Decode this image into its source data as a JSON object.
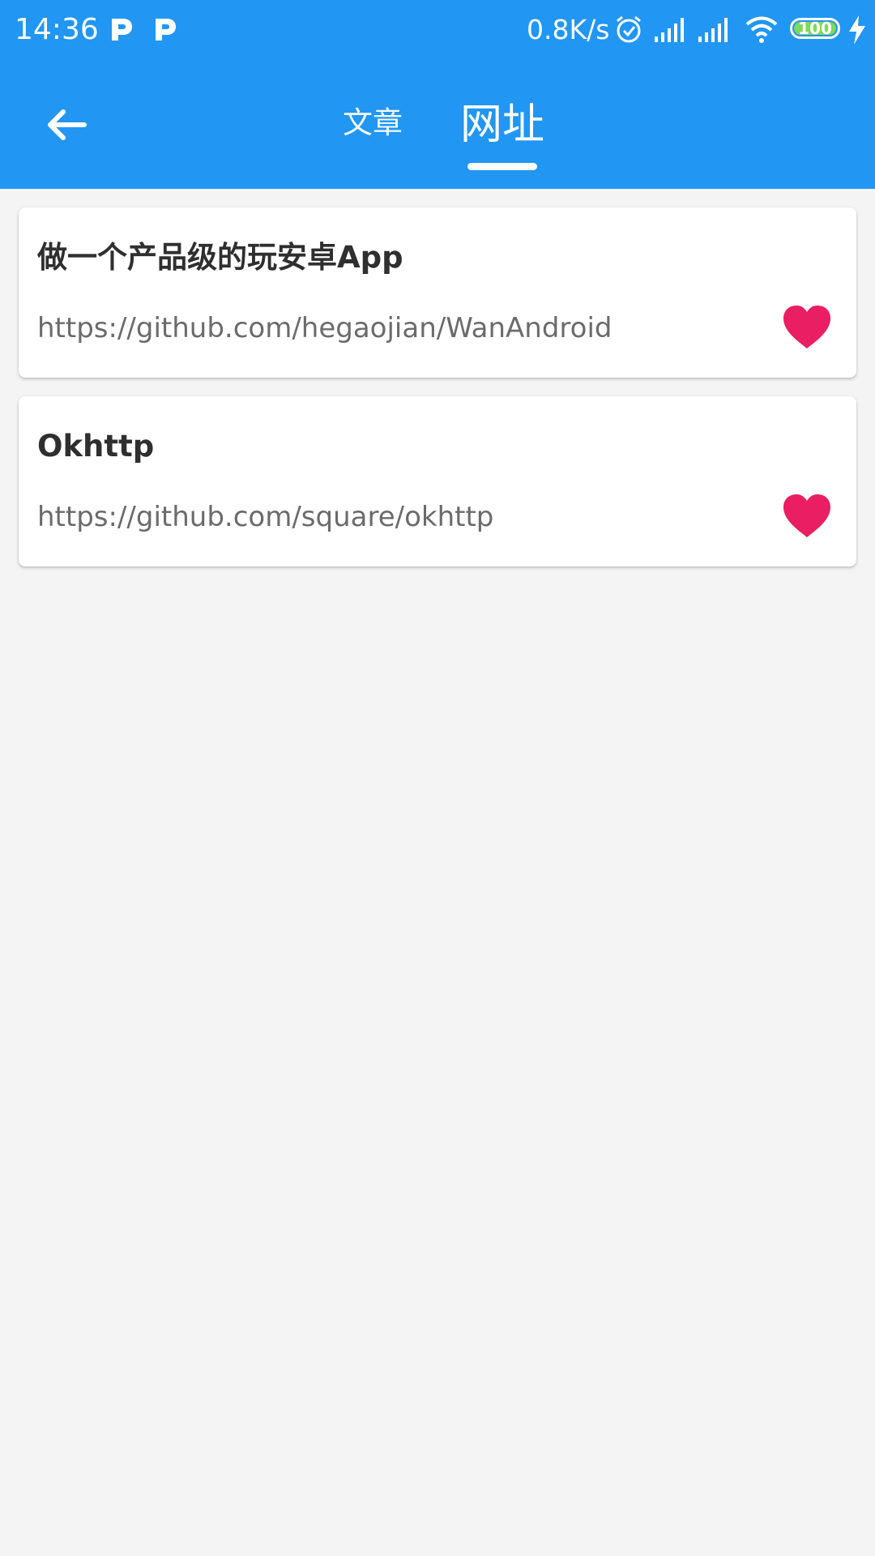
{
  "status_bar": {
    "time": "14:36",
    "net_speed": "0.8K/s",
    "battery": "100",
    "icons": [
      "parking-icon",
      "parking-icon",
      "alarm-icon",
      "signal-icon",
      "signal-icon",
      "wifi-icon",
      "battery-icon",
      "charging-icon"
    ]
  },
  "toolbar": {
    "tabs": [
      {
        "label": "文章"
      },
      {
        "label": "网址"
      }
    ],
    "selected_tab": "网址"
  },
  "collections": [
    {
      "title": "做一个产品级的玩安卓App",
      "url": "https://github.com/hegaojian/WanAndroid"
    },
    {
      "title": "Okhttp",
      "url": "https://github.com/square/okhttp"
    }
  ],
  "colors": {
    "app_bar": "#2196f3",
    "background": "#f4f4f4",
    "card": "#ffffff",
    "favorite": "#e91e63",
    "battery": "#7ed957"
  }
}
